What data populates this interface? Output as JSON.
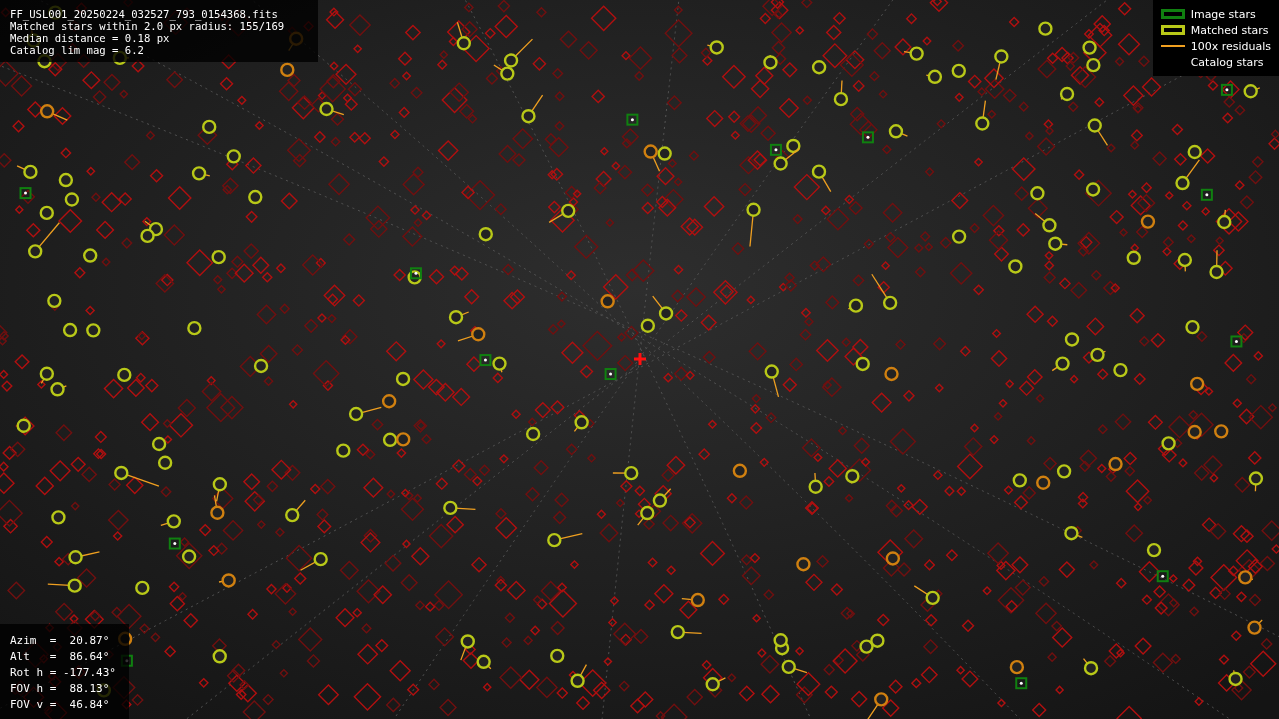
{
  "info_panel": {
    "lines": [
      "FF_USL001_20250224_032527_793_0154368.fits",
      "Matched stars within 2.0 px radius: 155/169",
      "Median distance = 0.18 px",
      "Catalog lim mag = 6.2"
    ]
  },
  "legend": [
    {
      "kind": "image",
      "label": "Image stars"
    },
    {
      "kind": "matched",
      "label": "Matched stars"
    },
    {
      "kind": "residual",
      "label": "100x residuals"
    },
    {
      "kind": "catalog",
      "label": "Catalog stars"
    }
  ],
  "pointing_panel": {
    "lines": [
      "Azim  =  20.87°",
      "Alt   =  86.64°",
      "Rot h = -177.43°",
      "FOV h =  88.13°",
      "FOV v =  46.84°"
    ]
  }
}
